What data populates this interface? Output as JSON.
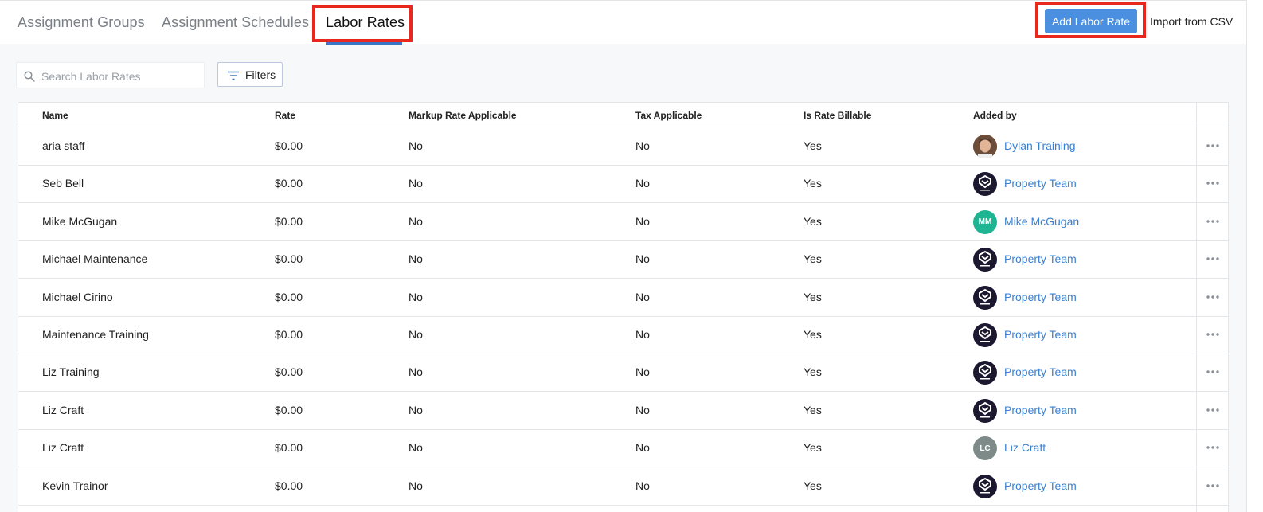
{
  "tabs": [
    {
      "label": "Assignment Groups"
    },
    {
      "label": "Assignment Schedules"
    },
    {
      "label": "Labor Rates"
    }
  ],
  "actions": {
    "add_label": "Add Labor Rate",
    "import_label": "Import from CSV"
  },
  "search": {
    "placeholder": "Search Labor Rates"
  },
  "filters": {
    "label": "Filters"
  },
  "table": {
    "columns": [
      "Name",
      "Rate",
      "Markup Rate Applicable",
      "Tax Applicable",
      "Is Rate Billable",
      "Added by"
    ],
    "rows": [
      {
        "name": "aria staff",
        "rate": "$0.00",
        "markup": "No",
        "tax": "No",
        "billable": "Yes",
        "added_by": "Dylan Training",
        "avatar": "photo"
      },
      {
        "name": "Seb Bell",
        "rate": "$0.00",
        "markup": "No",
        "tax": "No",
        "billable": "Yes",
        "added_by": "Property Team",
        "avatar": "logo"
      },
      {
        "name": "Mike McGugan",
        "rate": "$0.00",
        "markup": "No",
        "tax": "No",
        "billable": "Yes",
        "added_by": "Mike McGugan",
        "avatar": "initials",
        "initials": "MM",
        "avatar_color": "#1fb592"
      },
      {
        "name": "Michael Maintenance",
        "rate": "$0.00",
        "markup": "No",
        "tax": "No",
        "billable": "Yes",
        "added_by": "Property Team",
        "avatar": "logo"
      },
      {
        "name": "Michael Cirino",
        "rate": "$0.00",
        "markup": "No",
        "tax": "No",
        "billable": "Yes",
        "added_by": "Property Team",
        "avatar": "logo"
      },
      {
        "name": "Maintenance Training",
        "rate": "$0.00",
        "markup": "No",
        "tax": "No",
        "billable": "Yes",
        "added_by": "Property Team",
        "avatar": "logo"
      },
      {
        "name": "Liz Training",
        "rate": "$0.00",
        "markup": "No",
        "tax": "No",
        "billable": "Yes",
        "added_by": "Property Team",
        "avatar": "logo"
      },
      {
        "name": "Liz Craft",
        "rate": "$0.00",
        "markup": "No",
        "tax": "No",
        "billable": "Yes",
        "added_by": "Property Team",
        "avatar": "logo"
      },
      {
        "name": "Liz Craft",
        "rate": "$0.00",
        "markup": "No",
        "tax": "No",
        "billable": "Yes",
        "added_by": "Liz Craft",
        "avatar": "initials",
        "initials": "LC",
        "avatar_color": "#7d8a88"
      },
      {
        "name": "Kevin Trainor",
        "rate": "$0.00",
        "markup": "No",
        "tax": "No",
        "billable": "Yes",
        "added_by": "Property Team",
        "avatar": "logo"
      }
    ]
  },
  "colors": {
    "accent": "#4a8fe0",
    "link": "#3a80d2",
    "highlight": "#e8281c",
    "logo_bg": "#1b1830"
  }
}
